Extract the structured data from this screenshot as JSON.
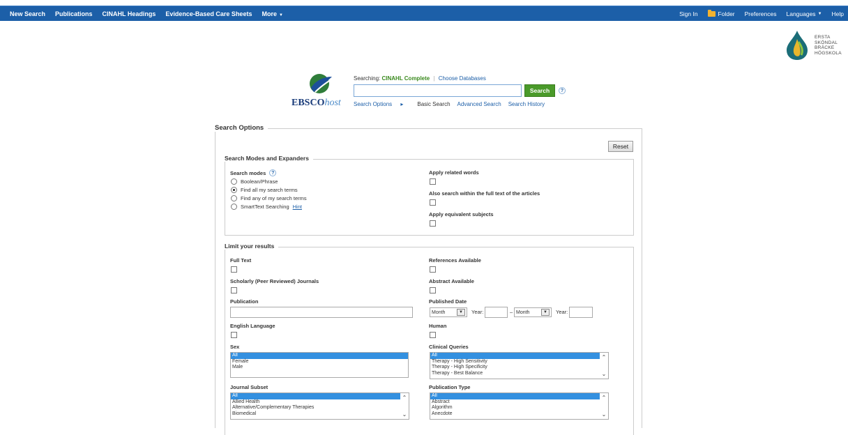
{
  "topnav": {
    "left": [
      "New Search",
      "Publications",
      "CINAHL Headings",
      "Evidence-Based Care Sheets",
      "More"
    ],
    "right": [
      "Sign In",
      "Folder",
      "Preferences",
      "Languages",
      "Help"
    ]
  },
  "institution": {
    "lines": [
      "ERSTA",
      "SKÖNDAL",
      "BRÄCKE",
      "HÖGSKOLA"
    ]
  },
  "ebsco": {
    "word": "EBSCO",
    "host": "host"
  },
  "search": {
    "searching_label": "Searching:",
    "database": "CINAHL Complete",
    "choose_databases": "Choose Databases",
    "query": "",
    "button": "Search",
    "help": "?",
    "links": {
      "options": "Search Options",
      "basic": "Basic Search",
      "advanced": "Advanced Search",
      "history": "Search History"
    }
  },
  "options": {
    "title": "Search Options",
    "reset": "Reset",
    "modes": {
      "title": "Search Modes and Expanders",
      "label": "Search modes",
      "items": [
        "Boolean/Phrase",
        "Find all my search terms",
        "Find any of my search terms",
        "SmartText Searching"
      ],
      "selected": 1,
      "hint": "Hint",
      "expanders": [
        "Apply related words",
        "Also search within the full text of the articles",
        "Apply equivalent subjects"
      ]
    },
    "limits": {
      "title": "Limit your results",
      "full_text": "Full Text",
      "references": "References Available",
      "scholarly": "Scholarly (Peer Reviewed) Journals",
      "abstract": "Abstract Available",
      "publication": "Publication",
      "published_date": "Published Date",
      "month": "Month",
      "year": "Year:",
      "dash": "–",
      "english": "English Language",
      "human": "Human",
      "sex": {
        "label": "Sex",
        "options": [
          "All",
          "Female",
          "Male"
        ]
      },
      "clinical": {
        "label": "Clinical Queries",
        "options": [
          "All",
          "Therapy - High Sensitivity",
          "Therapy - High Specificity",
          "Therapy - Best Balance"
        ]
      },
      "journal_subset": {
        "label": "Journal Subset",
        "options": [
          "All",
          "Allied Health",
          "Alternative/Complementary Therapies",
          "Biomedical"
        ]
      },
      "publication_type": {
        "label": "Publication Type",
        "options": [
          "All",
          "Abstract",
          "Algorithm",
          "Anecdote"
        ]
      }
    }
  },
  "colors": {
    "topbar": "#1c5fa8",
    "search_button": "#4a9a2a",
    "database": "#3a8a1e",
    "selected": "#3390e0"
  }
}
